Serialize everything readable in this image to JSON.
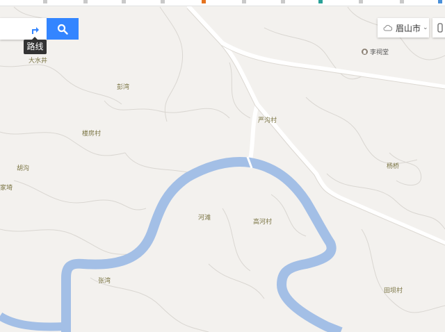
{
  "toolbar": {
    "route_tooltip": "路线",
    "route_icon": "route-arrow-icon",
    "search_icon": "search-icon"
  },
  "city": {
    "name": "眉山市",
    "weather_icon": "cloud-icon",
    "dropdown_icon": "chevron-down-icon"
  },
  "map": {
    "river_color": "#a3bfe6",
    "land_color": "#f3f1ee",
    "road_color": "#ffffff",
    "poi": {
      "name": "李祠堂",
      "icon": "temple-icon"
    },
    "places": [
      "大水井",
      "彭湾",
      "楼房村",
      "胡沟",
      "家埼",
      "严沟村",
      "杨桥",
      "河滩",
      "高河村",
      "张湾",
      "田坝村"
    ]
  }
}
